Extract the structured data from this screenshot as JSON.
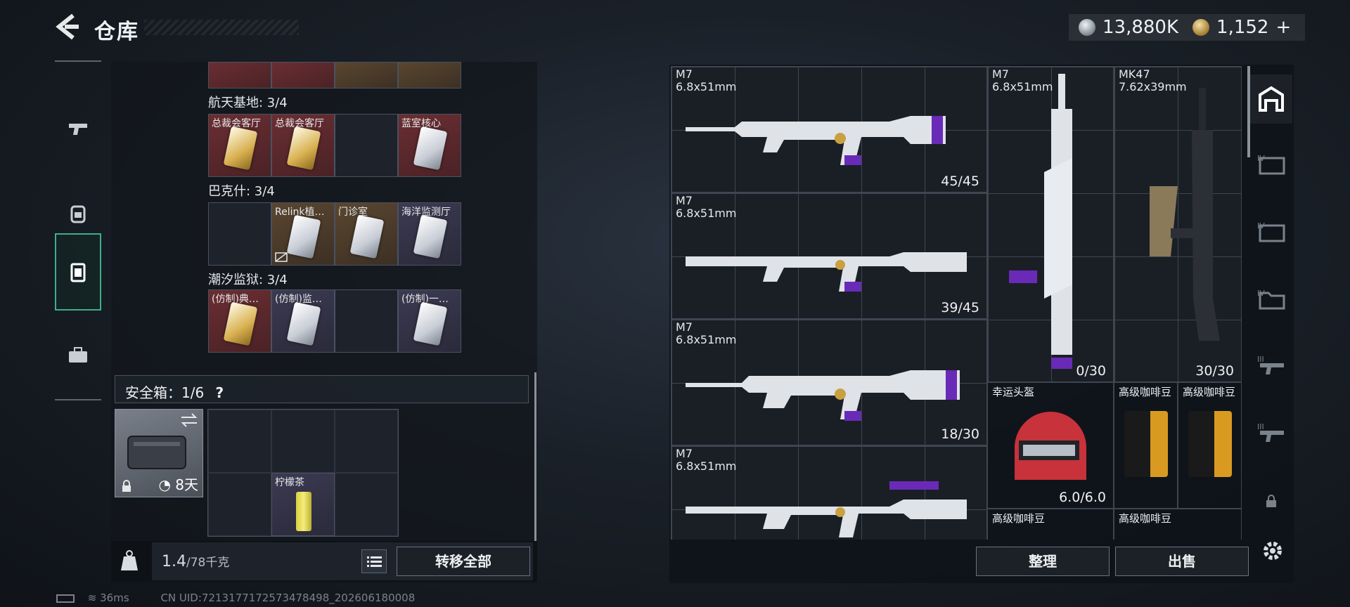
{
  "header": {
    "title": "仓库",
    "silver_amount": "13,880K",
    "gold_amount": "1,152",
    "gold_plus": "+"
  },
  "left_nav": [
    "gun-icon",
    "backpack-icon",
    "container-icon",
    "toolbox-icon"
  ],
  "collections": [
    {
      "title": "航天基地: 3/4",
      "cells": [
        {
          "label": "总裁会客厅",
          "style": "red",
          "card": "gold"
        },
        {
          "label": "总裁会客厅",
          "style": "red",
          "card": "gold"
        },
        {
          "label": "",
          "style": "grey",
          "card": ""
        },
        {
          "label": "蓝室核心",
          "style": "red",
          "card": "white"
        }
      ]
    },
    {
      "title": "巴克什: 3/4",
      "cells": [
        {
          "label": "",
          "style": "grey",
          "card": ""
        },
        {
          "label": "Relink植…",
          "style": "gold",
          "card": "white"
        },
        {
          "label": "门诊室",
          "style": "gold",
          "card": "white"
        },
        {
          "label": "海洋监测厅",
          "style": "purple",
          "card": "white"
        }
      ]
    },
    {
      "title": "潮汐监狱: 3/4",
      "cells": [
        {
          "label": "(仿制)典…",
          "style": "red",
          "card": "gold"
        },
        {
          "label": "(仿制)监…",
          "style": "purple",
          "card": "white"
        },
        {
          "label": "",
          "style": "grey",
          "card": ""
        },
        {
          "label": "(仿制)一…",
          "style": "purple",
          "card": "white"
        }
      ]
    }
  ],
  "safe": {
    "label": "安全箱：1/6",
    "help": "?",
    "days": "8天",
    "item_label": "柠檬茶"
  },
  "weight": {
    "current": "1.4",
    "max": "/78千克"
  },
  "buttons": {
    "transfer_all": "转移全部",
    "sort": "整理",
    "sell": "出售"
  },
  "status": {
    "ping": "36ms",
    "uid": "CN UID:7213177172573478498_202606180008"
  },
  "weapons": [
    {
      "name": "M7",
      "caliber": "6.8x51mm",
      "ammo": "45/45"
    },
    {
      "name": "M7",
      "caliber": "6.8x51mm",
      "ammo": "39/45"
    },
    {
      "name": "M7",
      "caliber": "6.8x51mm",
      "ammo": "18/30"
    },
    {
      "name": "M7",
      "caliber": "6.8x51mm",
      "ammo": ""
    },
    {
      "name": "M7",
      "caliber": "6.8x51mm",
      "ammo": "0/30"
    },
    {
      "name": "MK47",
      "caliber": "7.62x39mm",
      "ammo": "30/30"
    }
  ],
  "items": [
    {
      "name": "幸运头盔",
      "value": "6.0/6.0"
    },
    {
      "name": "高级咖啡豆",
      "value": ""
    },
    {
      "name": "高级咖啡豆",
      "value": ""
    },
    {
      "name": "高级咖啡豆",
      "value": ""
    },
    {
      "name": "高级咖啡豆",
      "value": ""
    }
  ],
  "right_nav": [
    "storage-home-icon",
    "tier-4-case-icon",
    "tier-4-case-icon",
    "tier-4-folder-icon",
    "tier-3-gun-icon",
    "tier-3-gun-icon",
    "lock-icon"
  ]
}
